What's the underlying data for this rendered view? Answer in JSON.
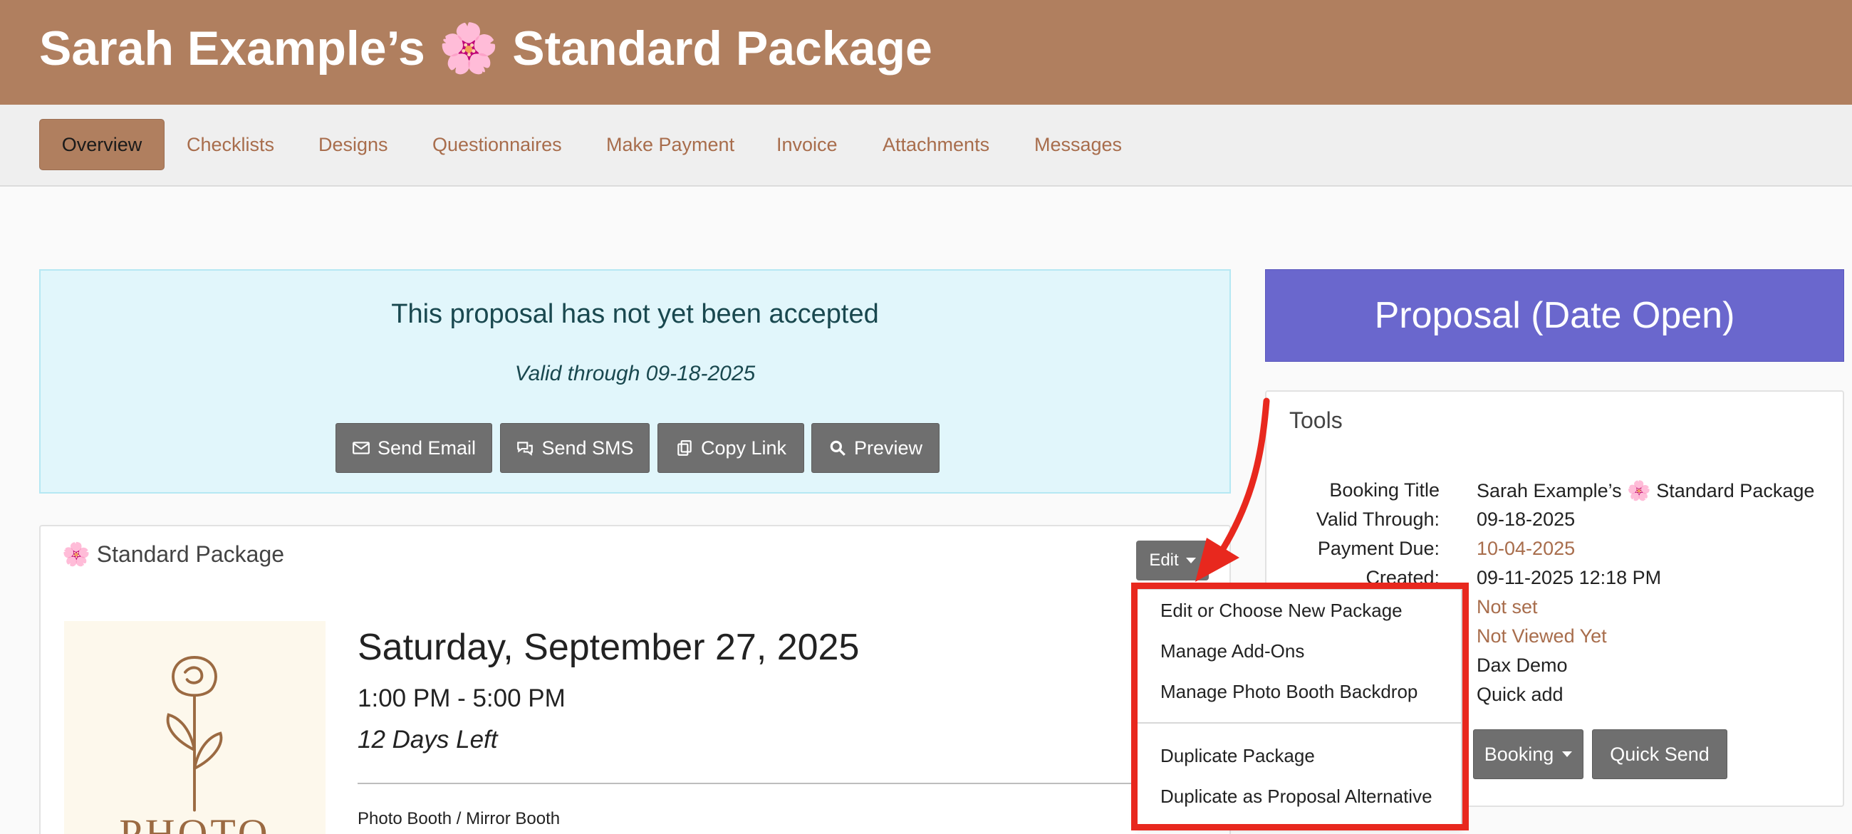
{
  "header": {
    "title": "Sarah Example’s 🌸 Standard Package"
  },
  "nav": {
    "tabs": [
      {
        "label": "Overview",
        "active": true
      },
      {
        "label": "Checklists"
      },
      {
        "label": "Designs"
      },
      {
        "label": "Questionnaires"
      },
      {
        "label": "Make Payment"
      },
      {
        "label": "Invoice"
      },
      {
        "label": "Attachments"
      },
      {
        "label": "Messages"
      }
    ]
  },
  "alert": {
    "title": "This proposal has not yet been accepted",
    "valid": "Valid through 09-18-2025",
    "buttons": {
      "send_email": "Send Email",
      "send_sms": "Send SMS",
      "copy_link": "Copy Link",
      "preview": "Preview"
    }
  },
  "status": {
    "label": "Proposal (Date Open)",
    "color": "#6a67cd"
  },
  "tools": {
    "title": "Tools",
    "rows": [
      {
        "label": "Booking Title",
        "value": "Sarah Example’s 🌸 Standard Package"
      },
      {
        "label": "Valid Through:",
        "value": "09-18-2025"
      },
      {
        "label": "Payment Due:",
        "value": "10-04-2025"
      },
      {
        "label": "Created:",
        "value": "09-11-2025 12:18 PM"
      },
      {
        "label": "",
        "value": "Not set"
      },
      {
        "label": "",
        "value": "Not Viewed Yet"
      },
      {
        "label": "",
        "value": "Dax Demo"
      },
      {
        "label": "",
        "value": "Quick add"
      }
    ],
    "booking_button": "Booking",
    "quick_send_button": "Quick Send"
  },
  "package": {
    "title": "🌸 Standard Package",
    "edit_button": "Edit",
    "image_text": "PHOTO",
    "date": "Saturday, September 27, 2025",
    "time": "1:00 PM - 5:00 PM",
    "days_left": "12 Days Left",
    "booth": "Photo Booth / Mirror Booth"
  },
  "dropdown": {
    "items": [
      "Edit or Choose New Package",
      "Manage Add-Ons",
      "Manage Photo Booth Backdrop",
      "Duplicate Package",
      "Duplicate as Proposal Alternative"
    ]
  },
  "colors": {
    "brand": "#b07f5f",
    "link": "#a86d4c",
    "highlight": "#e8281e",
    "alert_bg": "#e1f6fb"
  }
}
